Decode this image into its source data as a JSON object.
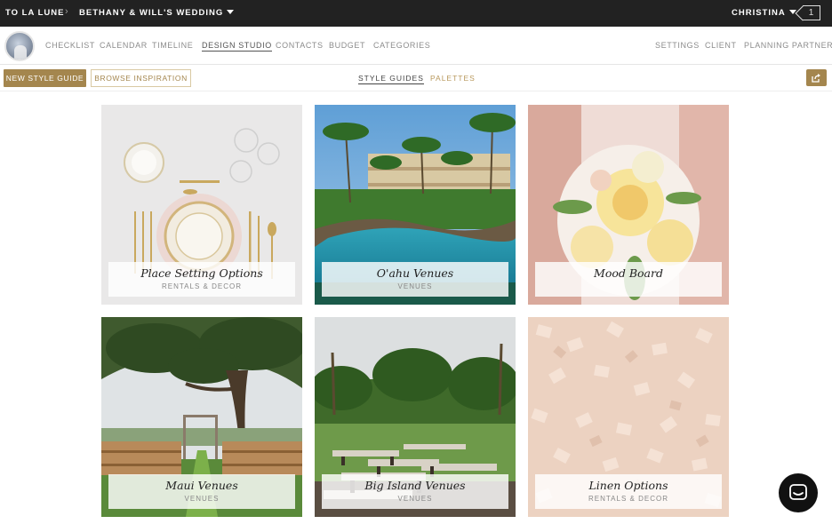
{
  "topbar": {
    "org": "TO LA LUNE",
    "separator": "›",
    "project": "BETHANY & WILL'S WEDDING",
    "user": "CHRISTINA",
    "notification_count": "1"
  },
  "nav": {
    "items": [
      "CHECKLIST",
      "CALENDAR",
      "TIMELINE",
      "DESIGN STUDIO",
      "CONTACTS",
      "BUDGET",
      "CATEGORIES"
    ],
    "active": "DESIGN STUDIO",
    "right_items": [
      "SETTINGS",
      "CLIENT",
      "PLANNING PARTNERS"
    ]
  },
  "toolbar": {
    "new_style_guide": "NEW STYLE GUIDE",
    "browse_inspiration": "BROWSE INSPIRATION",
    "tabs": [
      "STYLE GUIDES",
      "PALETTES"
    ],
    "active_tab": "STYLE GUIDES"
  },
  "cards": [
    {
      "title": "Place Setting Options",
      "subtitle": "RENTALS & DECOR",
      "icon": "place-setting-photo"
    },
    {
      "title": "O'ahu Venues",
      "subtitle": "VENUES",
      "icon": "resort-pool-photo"
    },
    {
      "title": "Mood Board",
      "subtitle": "",
      "icon": "bouquet-photo"
    },
    {
      "title": "Maui Venues",
      "subtitle": "VENUES",
      "icon": "ceremony-tree-photo"
    },
    {
      "title": "Big Island Venues",
      "subtitle": "VENUES",
      "icon": "garden-benches-photo"
    },
    {
      "title": "Linen Options",
      "subtitle": "RENTALS & DECOR",
      "icon": "sequin-linen-photo"
    }
  ],
  "colors": {
    "topbar": "#222222",
    "accent_gold": "#a4864e",
    "chat": "#111111"
  },
  "chat": {
    "icon": "chat-icon"
  },
  "share": {
    "icon": "share-icon"
  }
}
